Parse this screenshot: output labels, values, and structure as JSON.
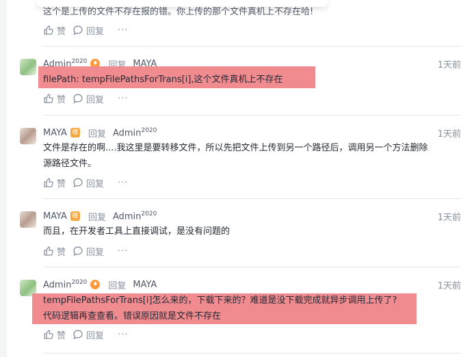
{
  "top": {
    "text": "这个是上传的文件不存在报的错。你上传的那个文件真机上不存在哈!",
    "like": "赞",
    "reply": "回复",
    "more": "···"
  },
  "comments": [
    {
      "user": "Admin",
      "sup": "2020",
      "badge": "flame",
      "reply_word": "回复",
      "target": "MAYA",
      "target_sup": "",
      "time": "1天前",
      "lines": [
        "filePath: tempFilePathsForTrans[i],这个文件真机上不存在"
      ],
      "like": "赞",
      "reply": "回复",
      "more": "···"
    },
    {
      "user": "MAYA",
      "sup": "",
      "badge": "楼",
      "reply_word": "回复",
      "target": "Admin",
      "target_sup": "2020",
      "time": "1天前",
      "lines": [
        "文件是存在的啊....我这里是要转移文件，所以先把文件上传到另一个路径后，调用另一个方法删除",
        "源路径文件。"
      ],
      "like": "赞",
      "reply": "回复",
      "more": "···"
    },
    {
      "user": "MAYA",
      "sup": "",
      "badge": "楼",
      "reply_word": "回复",
      "target": "Admin",
      "target_sup": "2020",
      "time": "1天前",
      "lines": [
        "而且，在开发者工具上直接调试，是没有问题的"
      ],
      "like": "赞",
      "reply": "回复",
      "more": "···"
    },
    {
      "user": "Admin",
      "sup": "2020",
      "badge": "flame",
      "reply_word": "回复",
      "target": "MAYA",
      "target_sup": "",
      "time": "1天前",
      "lines": [
        "tempFilePathsForTrans[i]怎么来的，下载下来的？难道是没下载完成就异步调用上传了?",
        "代码逻辑再查查看。错误原因就是文件不存在"
      ],
      "like": "赞",
      "reply": "回复",
      "more": "···"
    }
  ],
  "colors": {
    "highlight": "#f08c90",
    "muted": "#8a919f",
    "text": "#252933"
  },
  "icons": {
    "like": "thumbs-up-icon",
    "comment": "comment-icon",
    "badge_flame": "flame-icon"
  }
}
